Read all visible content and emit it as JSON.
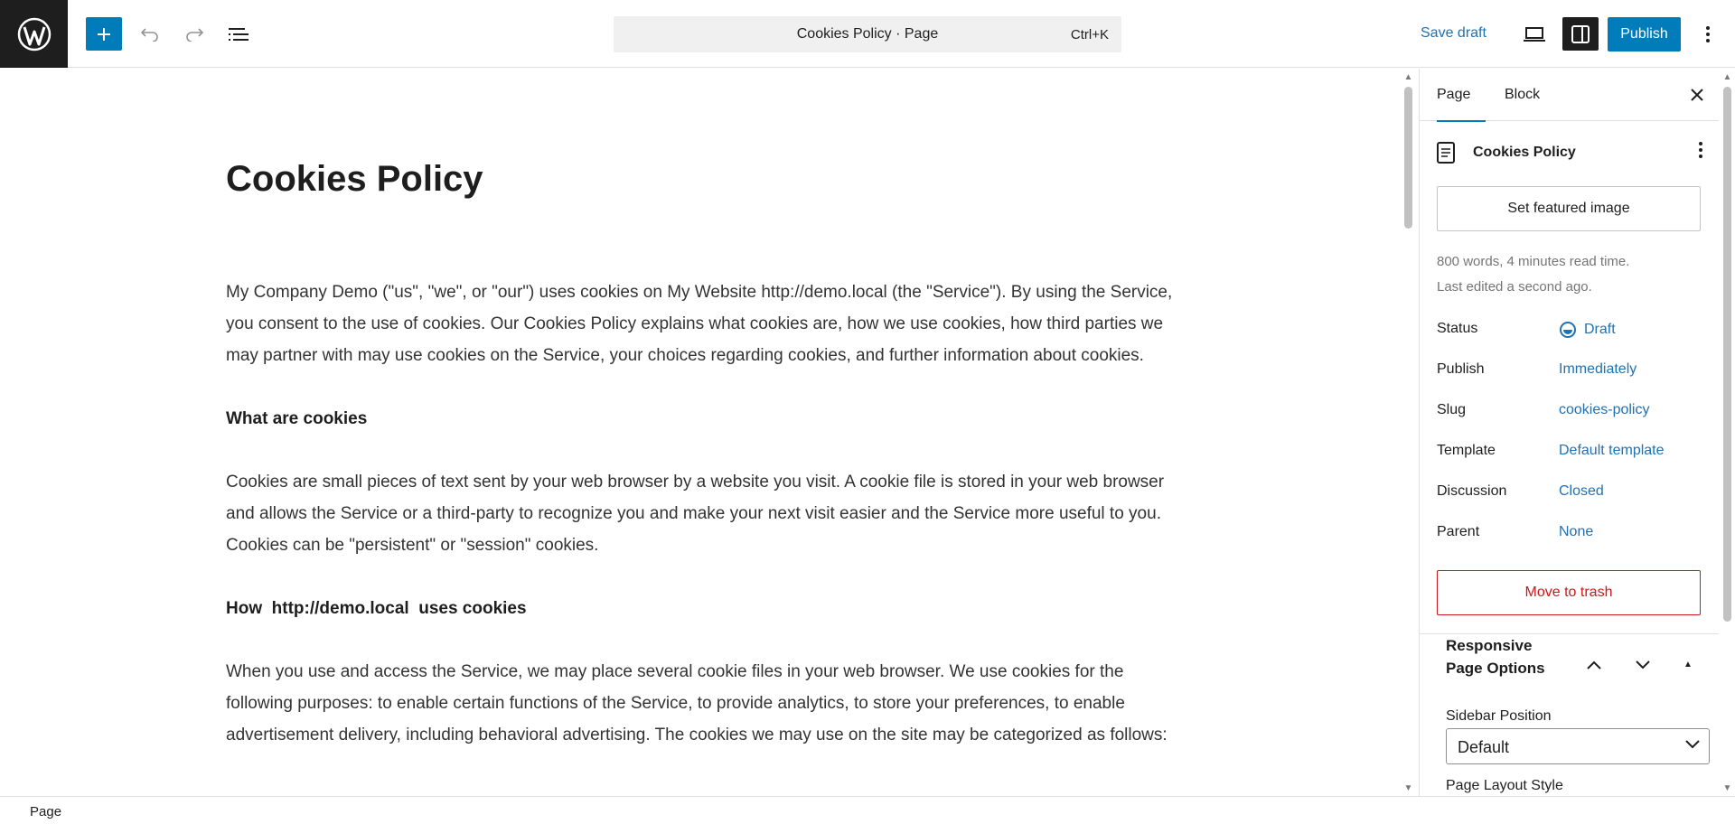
{
  "header": {
    "command_bar": {
      "title": "Cookies Policy · Page",
      "shortcut": "Ctrl+K"
    },
    "save_draft_label": "Save draft",
    "publish_label": "Publish",
    "icons": [
      "wordpress-logo",
      "plus-icon",
      "undo-icon",
      "redo-icon",
      "document-overview-icon",
      "desktop-preview-icon",
      "settings-sidebar-icon",
      "options-kebab-icon"
    ]
  },
  "editor": {
    "title": "Cookies Policy",
    "blocks": [
      {
        "type": "p",
        "text": "My Company Demo (\"us\", \"we\", or \"our\") uses cookies on My Website http://demo.local (the \"Service\"). By using the Service, you consent to the use of cookies. Our Cookies Policy explains what cookies are, how we use cookies, how third parties we may partner with may use cookies on the Service, your choices regarding cookies, and further information about cookies."
      },
      {
        "type": "h",
        "text": "What are cookies"
      },
      {
        "type": "p",
        "text": "Cookies are small pieces of text sent by your web browser by a website you visit. A cookie file is stored in your web browser and allows the Service or a third-party to recognize you and make your next visit easier and the Service more useful to you. Cookies can be \"persistent\" or \"session\" cookies."
      },
      {
        "type": "h",
        "text": "How  http://demo.local  uses cookies"
      },
      {
        "type": "p",
        "text": "When you use and access the Service, we may place several cookie files in your web browser. We use cookies for the following purposes: to enable certain functions of the Service, to provide analytics, to store your preferences, to enable advertisement delivery, including behavioral advertising. The cookies we may use on the site may be categorized as follows:"
      }
    ]
  },
  "sidebar": {
    "tabs": [
      {
        "label": "Page",
        "active": true
      },
      {
        "label": "Block",
        "active": false
      }
    ],
    "post_title": "Cookies Policy",
    "featured_image_label": "Set featured image",
    "meta": {
      "words": "800 words, 4 minutes read time.",
      "edited": "Last edited a second ago."
    },
    "rows": [
      {
        "label": "Status",
        "value": "Draft"
      },
      {
        "label": "Publish",
        "value": "Immediately"
      },
      {
        "label": "Slug",
        "value": "cookies-policy"
      },
      {
        "label": "Template",
        "value": "Default template"
      },
      {
        "label": "Discussion",
        "value": "Closed"
      },
      {
        "label": "Parent",
        "value": "None"
      }
    ],
    "trash_label": "Move to trash",
    "responsive_panel": {
      "title": "Responsive Page Options",
      "sidebar_position_label": "Sidebar Position",
      "sidebar_position_value": "Default",
      "layout_style_label": "Page Layout Style"
    }
  },
  "footer": {
    "breadcrumb": "Page"
  },
  "colors": {
    "accent": "#007cba",
    "link": "#2271b1",
    "danger": "#cc1818",
    "dark": "#1e1e1e"
  }
}
